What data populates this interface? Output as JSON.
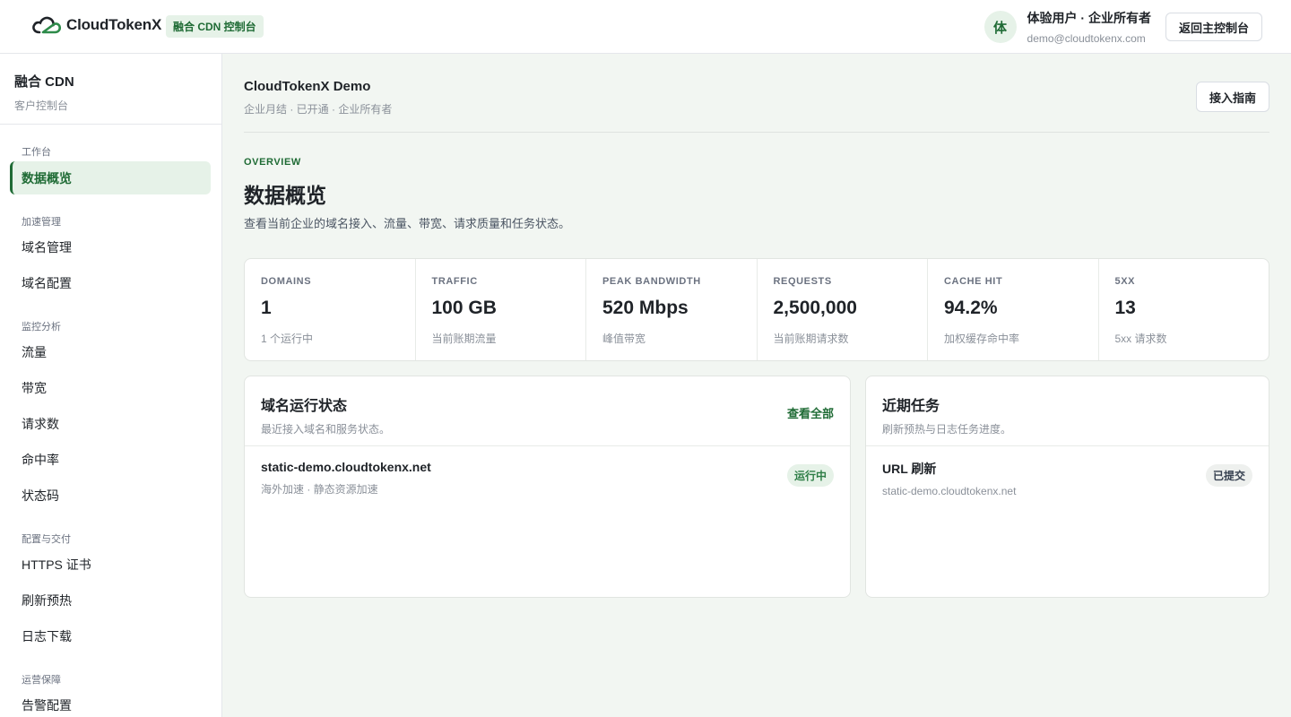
{
  "header": {
    "logo_text": "CloudTokenX",
    "console_badge": "融合 CDN 控制台",
    "avatar_initial": "体",
    "user_name": "体验用户 · 企业所有者",
    "user_email": "demo@cloudtokenx.com",
    "back_button": "返回主控制台"
  },
  "sidebar": {
    "title": "融合 CDN",
    "subtitle": "客户控制台",
    "sections": [
      {
        "label": "工作台",
        "items": [
          {
            "label": "数据概览",
            "active": true
          }
        ]
      },
      {
        "label": "加速管理",
        "items": [
          {
            "label": "域名管理"
          },
          {
            "label": "域名配置"
          }
        ]
      },
      {
        "label": "监控分析",
        "items": [
          {
            "label": "流量"
          },
          {
            "label": "带宽"
          },
          {
            "label": "请求数"
          },
          {
            "label": "命中率"
          },
          {
            "label": "状态码"
          }
        ]
      },
      {
        "label": "配置与交付",
        "items": [
          {
            "label": "HTTPS 证书"
          },
          {
            "label": "刷新预热"
          },
          {
            "label": "日志下载"
          }
        ]
      },
      {
        "label": "运营保障",
        "items": [
          {
            "label": "告警配置"
          }
        ]
      }
    ]
  },
  "account": {
    "name": "CloudTokenX Demo",
    "meta": "企业月结 · 已开通 · 企业所有者",
    "guide_button": "接入指南"
  },
  "overview": {
    "eyebrow": "OVERVIEW",
    "title": "数据概览",
    "description": "查看当前企业的域名接入、流量、带宽、请求质量和任务状态。"
  },
  "stats": [
    {
      "label": "DOMAINS",
      "value": "1",
      "note": "1 个运行中"
    },
    {
      "label": "TRAFFIC",
      "value": "100 GB",
      "note": "当前账期流量"
    },
    {
      "label": "PEAK BANDWIDTH",
      "value": "520 Mbps",
      "note": "峰值带宽"
    },
    {
      "label": "REQUESTS",
      "value": "2,500,000",
      "note": "当前账期请求数"
    },
    {
      "label": "CACHE HIT",
      "value": "94.2%",
      "note": "加权缓存命中率"
    },
    {
      "label": "5XX",
      "value": "13",
      "note": "5xx 请求数"
    }
  ],
  "domain_card": {
    "title": "域名运行状态",
    "subtitle": "最近接入域名和服务状态。",
    "view_all": "查看全部",
    "rows": [
      {
        "name": "static-demo.cloudtokenx.net",
        "meta": "海外加速 · 静态资源加速",
        "status": "运行中"
      }
    ]
  },
  "task_card": {
    "title": "近期任务",
    "subtitle": "刷新预热与日志任务进度。",
    "rows": [
      {
        "name": "URL 刷新",
        "meta": "static-demo.cloudtokenx.net",
        "status": "已提交"
      }
    ]
  },
  "colors": {
    "accent": "#1f6b35",
    "accent_bg": "#e6f2e8",
    "main_bg": "#f2f6f2"
  }
}
